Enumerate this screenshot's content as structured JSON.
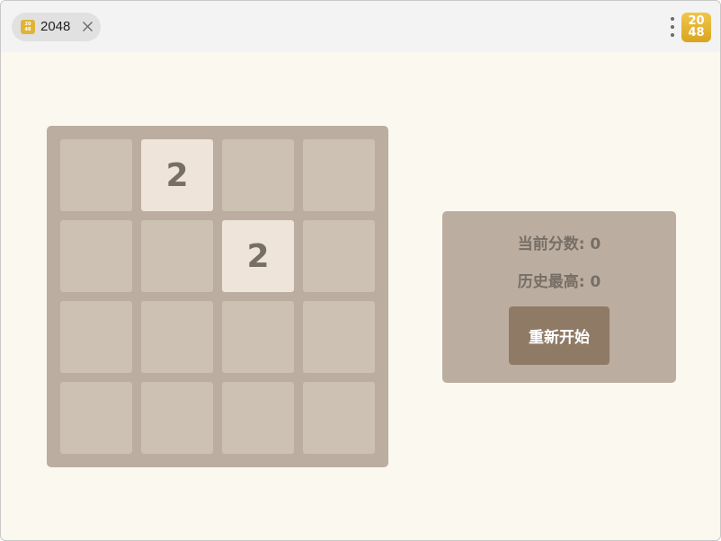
{
  "tab": {
    "title": "2048",
    "favicon_text": "20\n48"
  },
  "app_logo": {
    "line1": "20",
    "line2": "48"
  },
  "board": {
    "rows": [
      [
        "",
        "2",
        "",
        ""
      ],
      [
        "",
        "",
        "2",
        ""
      ],
      [
        "",
        "",
        "",
        ""
      ],
      [
        "",
        "",
        "",
        ""
      ]
    ]
  },
  "panel": {
    "current_score": "当前分数: 0",
    "best_score": "历史最高: 0",
    "restart_label": "重新开始"
  },
  "colors": {
    "background": "#faf8ef",
    "board": "#bbada0",
    "empty_cell": "#cdc1b4",
    "tile_2": "#eee4da",
    "tile_text": "#776e65",
    "button": "#8f7a66"
  },
  "icons": {
    "tab_close": "close-icon",
    "menu": "more-vertical-icon",
    "logo": "app-logo-icon"
  }
}
